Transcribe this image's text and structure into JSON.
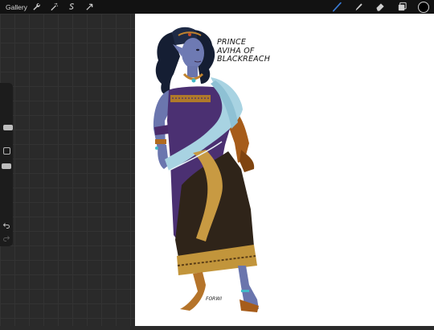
{
  "topbar": {
    "gallery_label": "Gallery",
    "left_tools": [
      "wrench-icon",
      "magic-wand-icon",
      "selection-icon",
      "transform-arrow-icon"
    ],
    "right_tools": [
      "brush-icon",
      "smudge-icon",
      "eraser-icon",
      "layers-icon"
    ],
    "brush_active_color": "#3a7bd5",
    "current_color": "#000000"
  },
  "sidebar": {
    "brush_size_level": 0.82,
    "opacity_level": 0.17
  },
  "artwork": {
    "title_lines": [
      "PRINCE",
      "AVIHA OF",
      "BLACKREACH"
    ],
    "signature": "FORWI"
  }
}
